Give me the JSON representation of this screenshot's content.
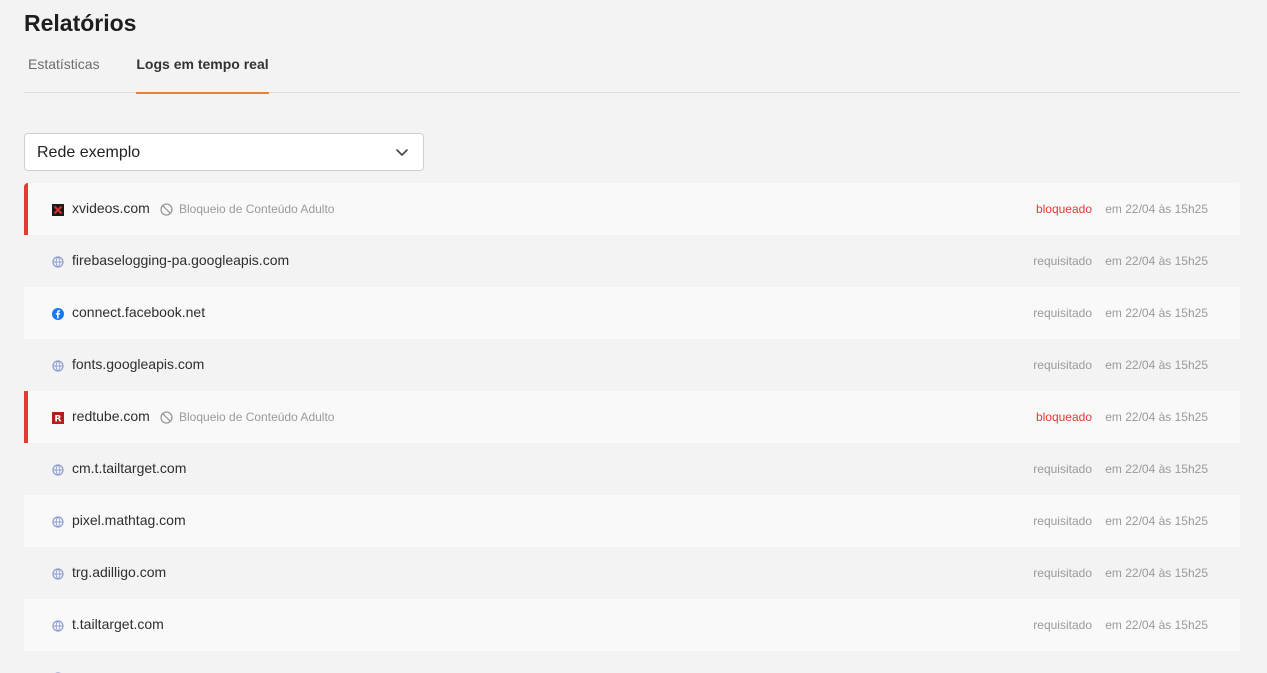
{
  "header": {
    "title": "Relatórios"
  },
  "tabs": [
    {
      "label": "Estatísticas",
      "active": false
    },
    {
      "label": "Logs em tempo real",
      "active": true
    }
  ],
  "network_select": {
    "value": "Rede exemplo"
  },
  "colors": {
    "accent": "#ee7f2d",
    "blocked": "#e53935"
  },
  "logs": [
    {
      "domain": "xvideos.com",
      "icon": "xvideos-icon",
      "category": "Bloqueio de Conteúdo Adulto",
      "status": "bloqueado",
      "time": "em 22/04 às 15h25"
    },
    {
      "domain": "firebaselogging-pa.googleapis.com",
      "icon": "globe-icon",
      "category": "",
      "status": "requisitado",
      "time": "em 22/04 às 15h25"
    },
    {
      "domain": "connect.facebook.net",
      "icon": "facebook-icon",
      "category": "",
      "status": "requisitado",
      "time": "em 22/04 às 15h25"
    },
    {
      "domain": "fonts.googleapis.com",
      "icon": "globe-icon",
      "category": "",
      "status": "requisitado",
      "time": "em 22/04 às 15h25"
    },
    {
      "domain": "redtube.com",
      "icon": "redtube-icon",
      "category": "Bloqueio de Conteúdo Adulto",
      "status": "bloqueado",
      "time": "em 22/04 às 15h25"
    },
    {
      "domain": "cm.t.tailtarget.com",
      "icon": "globe-icon",
      "category": "",
      "status": "requisitado",
      "time": "em 22/04 às 15h25"
    },
    {
      "domain": "pixel.mathtag.com",
      "icon": "globe-icon",
      "category": "",
      "status": "requisitado",
      "time": "em 22/04 às 15h25"
    },
    {
      "domain": "trg.adilligo.com",
      "icon": "globe-icon",
      "category": "",
      "status": "requisitado",
      "time": "em 22/04 às 15h25"
    },
    {
      "domain": "t.tailtarget.com",
      "icon": "globe-icon",
      "category": "",
      "status": "requisitado",
      "time": "em 22/04 às 15h25"
    },
    {
      "domain": "",
      "icon": "globe-icon",
      "category": "",
      "status": "",
      "time": ""
    }
  ]
}
